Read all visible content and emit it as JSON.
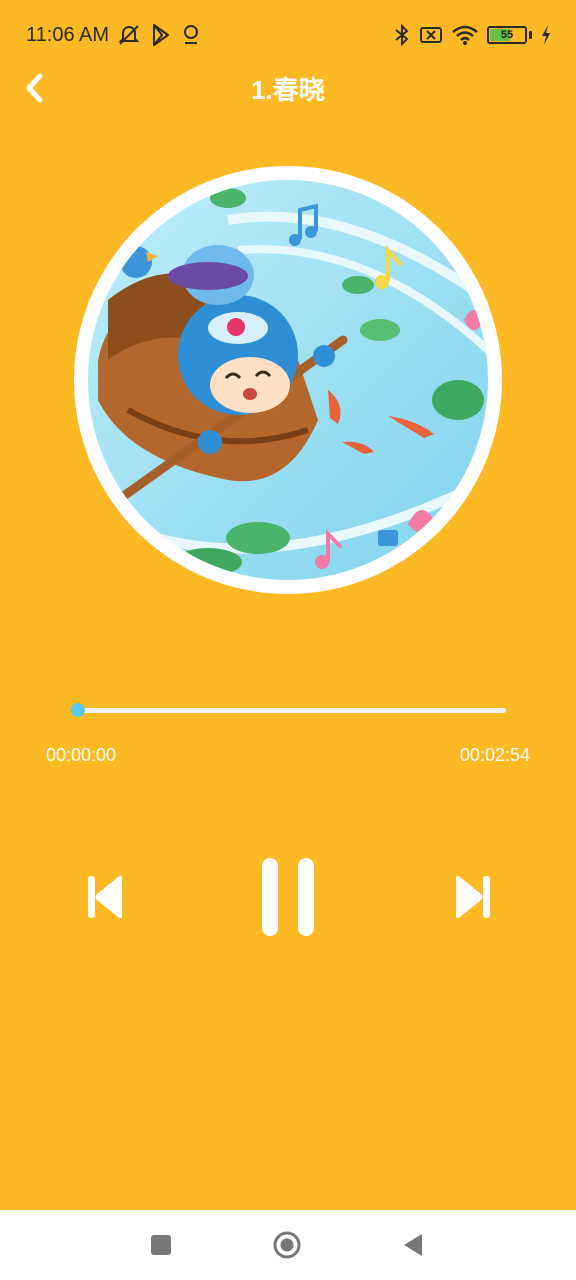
{
  "status_bar": {
    "time": "11:06 AM",
    "left_icons": [
      "muted-bell-icon",
      "play-store-icon",
      "location-pin-icon"
    ],
    "right_icons": [
      "bluetooth-icon",
      "no-sim-icon",
      "wifi-icon",
      "battery-icon",
      "charging-bolt-icon"
    ],
    "battery_level": "55"
  },
  "header": {
    "title": "1.春晓",
    "back_icon": "chevron-left-icon"
  },
  "player": {
    "current_time": "00:00:00",
    "total_time": "00:02:54",
    "progress": 0.0,
    "colors": {
      "background": "#FDB924",
      "accent": "#5AC8EF",
      "track": "#F2F2F2"
    },
    "controls": [
      "previous-track-icon",
      "pause-icon",
      "next-track-icon"
    ]
  },
  "nav_bar": {
    "buttons": [
      "recents-square-icon",
      "home-circle-icon",
      "back-triangle-icon"
    ]
  }
}
